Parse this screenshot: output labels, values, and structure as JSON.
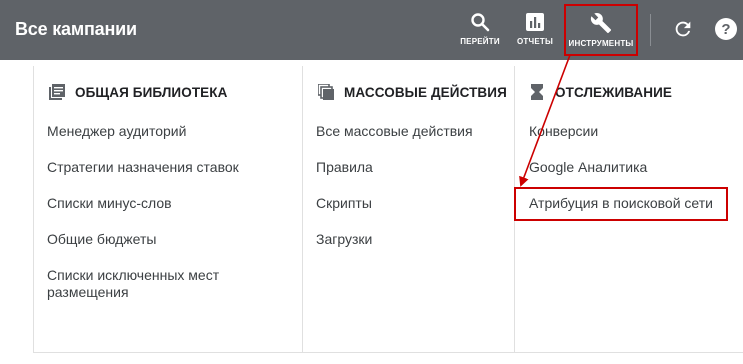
{
  "header": {
    "title": "Все кампании",
    "tools": [
      {
        "label": "ПЕРЕЙТИ",
        "icon": "search-icon"
      },
      {
        "label": "ОТЧЕТЫ",
        "icon": "reports-icon"
      },
      {
        "label": "ИНСТРУМЕНТЫ",
        "icon": "wrench-icon"
      }
    ],
    "refresh_icon": "refresh-icon",
    "help_icon": "help-icon"
  },
  "columns": [
    {
      "heading": "ОБЩАЯ БИБЛИОТЕКА",
      "icon": "library-icon",
      "items": [
        "Менеджер аудиторий",
        "Стратегии назначения ставок",
        "Списки минус-слов",
        "Общие бюджеты",
        "Списки исключенных мест размещения"
      ]
    },
    {
      "heading": "МАССОВЫЕ ДЕЙСТВИЯ",
      "icon": "bulk-actions-icon",
      "items": [
        "Все массовые действия",
        "Правила",
        "Скрипты",
        "Загрузки"
      ]
    },
    {
      "heading": "ОТСЛЕЖИВАНИЕ",
      "icon": "hourglass-icon",
      "items": [
        "Конверсии",
        "Google Аналитика",
        "Атрибуция в поисковой сети"
      ]
    }
  ],
  "colors": {
    "topbar": "#5f6368",
    "highlight": "#cc0000"
  }
}
